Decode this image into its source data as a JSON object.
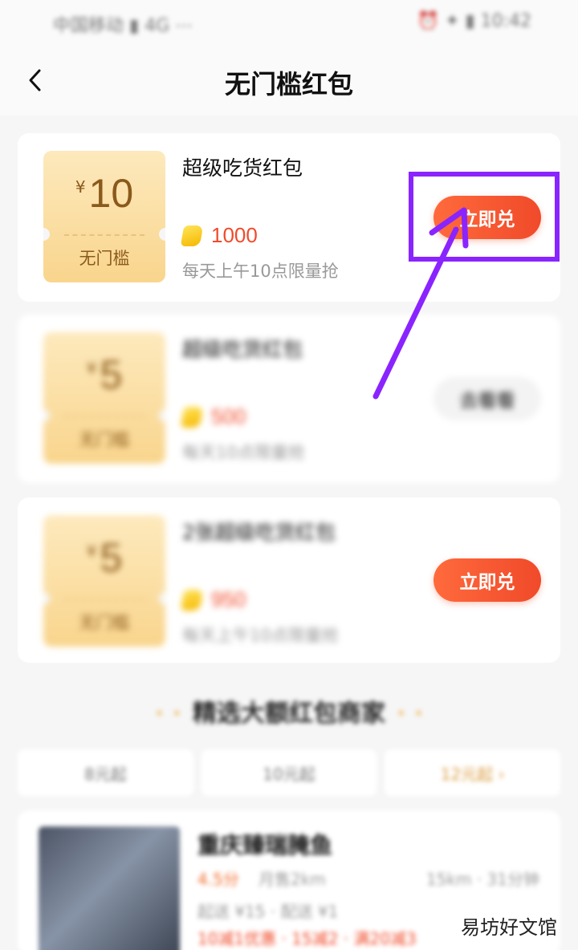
{
  "status_bar": {
    "carrier": "中国移动 ▮ 4G ⋯",
    "right": "⏰ ✦ ▮ 10:42"
  },
  "nav": {
    "back_icon": "chevron-left-icon",
    "title": "无门槛红包"
  },
  "vouchers": [
    {
      "currency": "¥",
      "amount": "10",
      "threshold": "无门槛",
      "title": "超级吃货红包",
      "points": "1000",
      "note": "每天上午10点限量抢",
      "button": "立即兑",
      "button_style": "active"
    },
    {
      "currency": "¥",
      "amount": "5",
      "threshold": "无门槛",
      "title": "超级吃货红包",
      "points": "500",
      "note": "每天10点限量抢",
      "button": "去看看",
      "button_style": "grey"
    },
    {
      "currency": "¥",
      "amount": "5",
      "threshold": "无门槛",
      "title": "2张超级吃货红包",
      "points": "950",
      "note": "每天上午10点限量抢",
      "button": "立即兑",
      "button_style": "active"
    }
  ],
  "section": {
    "title": "精选大额红包商家",
    "tabs": [
      "8元起",
      "10元起",
      "12元起 ›"
    ],
    "active_tab_index": 2
  },
  "shop": {
    "name": "重庆臻瑞腌鱼",
    "rating": "4.5分",
    "sales": "月售2km",
    "distance": "15km · 31分钟",
    "line3": "起送 ¥15 · 配送 ¥1",
    "line4": "10减1优惠 · 15减2 · 满20减3"
  },
  "annotation": {
    "highlight_color": "#8a24ff"
  },
  "watermark": "易坊好文馆",
  "colors": {
    "accent": "#f04a2a",
    "coupon_bg": "#fbe0a6",
    "coupon_text": "#8a5a1c"
  }
}
